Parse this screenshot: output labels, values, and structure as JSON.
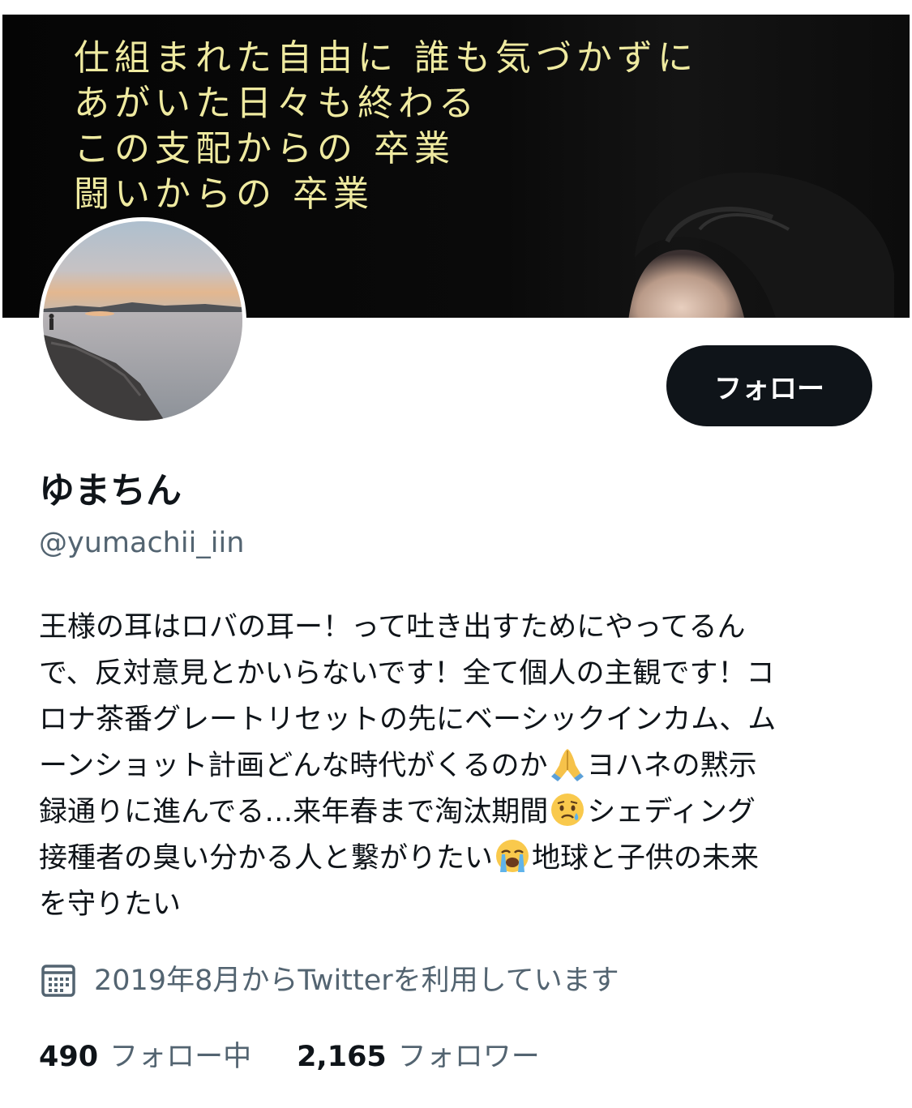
{
  "banner": {
    "caption_lines": [
      "仕組まれた自由に 誰も気づかずに",
      "あがいた日々も終わる",
      "この支配からの 卒業",
      "闘いからの 卒業"
    ]
  },
  "profile": {
    "display_name": "ゆまちん",
    "handle": "@yumachii_iin",
    "follow_label": "フォロー",
    "bio_lines": [
      "王様の耳はロバの耳ー！って吐き出すためにやってるん",
      "で、反対意見とかいらないです！全て個人の主観です！コ",
      "ロナ茶番グレートリセットの先にベーシックインカム、ム",
      "ーンショット計画どんな時代がくるのか",
      "ヨハネの黙示",
      "録通りに進んでる…来年春まで淘汰期間",
      "シェディング",
      "接種者の臭い分かる人と繋がりたい",
      "地球と子供の未来",
      "を守りたい"
    ],
    "bio_emojis": [
      "folded-hands-icon",
      "sad-relieved-face-icon",
      "loudly-crying-face-icon"
    ],
    "joined_text": "2019年8月からTwitterを利用しています",
    "following_count": "490",
    "following_label": "フォロー中",
    "followers_count": "2,165",
    "followers_label": "フォロワー"
  },
  "colors": {
    "text_primary": "#0f1419",
    "text_secondary": "#536471",
    "button_bg": "#0f1419",
    "banner_text": "#efeaa0"
  }
}
